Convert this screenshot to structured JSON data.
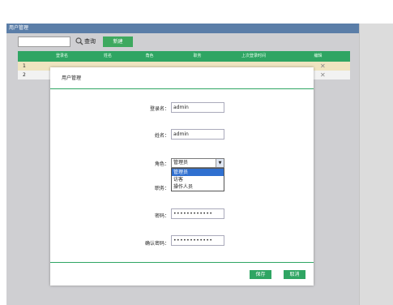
{
  "window": {
    "title": "用户管理"
  },
  "toolbar": {
    "search_value": "",
    "search_label": "查询",
    "new_label": "新建"
  },
  "table": {
    "headers": [
      "登录名",
      "姓名",
      "角色",
      "职务",
      "上次登录时间",
      "编辑"
    ],
    "rows": [
      {
        "num": "1",
        "delete": "✕"
      },
      {
        "num": "2",
        "delete": "✕"
      }
    ]
  },
  "modal": {
    "title": "用户管理",
    "login_label": "登录名：",
    "login_value": "admin",
    "name_label": "姓名：",
    "name_value": "admin",
    "role_label": "角色：",
    "role_value": "管理员",
    "role_options": [
      "管理员",
      "访客",
      "操作人员"
    ],
    "role_selected_index": 0,
    "position_label": "职务：",
    "password_label": "密码：",
    "password_value": "••••••••••••",
    "confirm_label": "确认密码：",
    "confirm_value": "••••••••••••",
    "save_label": "保存",
    "cancel_label": "取消"
  },
  "colors": {
    "accent": "#2fa563",
    "titlebar": "#5b7ea8",
    "selected_row": "#efe4c0",
    "option_highlight": "#3070d0"
  }
}
